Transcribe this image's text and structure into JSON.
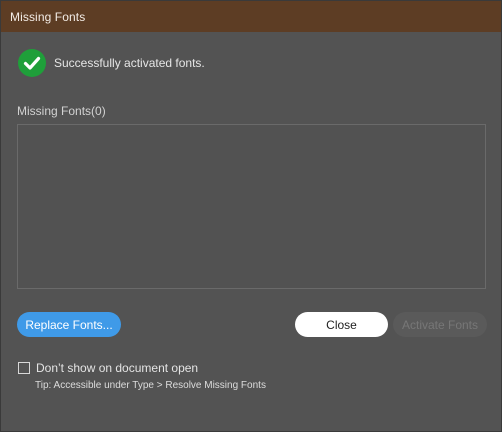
{
  "window": {
    "title": "Missing Fonts"
  },
  "status": {
    "icon": "checkmark-success-icon",
    "message": "Successfully activated fonts.",
    "color": "#1f9f3a"
  },
  "missing_fonts": {
    "label": "Missing Fonts(0)",
    "items": []
  },
  "buttons": {
    "replace_label": "Replace Fonts...",
    "close_label": "Close",
    "activate_label": "Activate Fonts"
  },
  "options": {
    "dont_show_label": "Don’t show on document open",
    "dont_show_checked": false,
    "tip": "Tip: Accessible under Type > Resolve Missing Fonts"
  },
  "colors": {
    "titlebar": "#5d3d24",
    "dialog_bg": "#535353",
    "primary_button": "#3f9ae8",
    "close_button": "#ffffff"
  }
}
